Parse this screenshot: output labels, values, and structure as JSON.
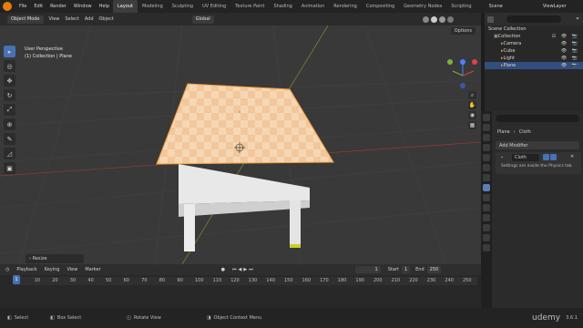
{
  "menu": [
    "File",
    "Edit",
    "Render",
    "Window",
    "Help"
  ],
  "workspaces": [
    "Layout",
    "Modeling",
    "Sculpting",
    "UV Editing",
    "Texture Paint",
    "Shading",
    "Animation",
    "Rendering",
    "Compositing",
    "Geometry Nodes",
    "Scripting"
  ],
  "scene": "Scene",
  "view_layer": "ViewLayer",
  "viewport": {
    "mode": "Object Mode",
    "menus": [
      "View",
      "Select",
      "Add",
      "Object"
    ],
    "orientation": "Global",
    "options": "Options",
    "overlay_line1": "User Perspective",
    "overlay_line2": "(1) Collection | Plane",
    "resize_panel": "Resize"
  },
  "outliner": {
    "scene_collection": "Scene Collection",
    "collection": "Collection",
    "items": [
      "Camera",
      "Cube",
      "Light",
      "Plane"
    ]
  },
  "properties": {
    "breadcrumb_object": "Plane",
    "breadcrumb_mod": "Cloth",
    "add_modifier": "Add Modifier",
    "mod_name": "Cloth",
    "info": "Settings are inside the Physics tab"
  },
  "timeline": {
    "menus": [
      "Playback",
      "Keying",
      "View",
      "Marker"
    ],
    "current": "1",
    "start_label": "Start",
    "start": "1",
    "end_label": "End",
    "end": "250",
    "ticks": [
      "1",
      "10",
      "20",
      "30",
      "40",
      "50",
      "60",
      "70",
      "80",
      "90",
      "100",
      "110",
      "120",
      "130",
      "140",
      "150",
      "160",
      "170",
      "180",
      "190",
      "200",
      "210",
      "220",
      "230",
      "240",
      "250"
    ]
  },
  "status": {
    "select": "Select",
    "box_select": "Box Select",
    "rotate": "Rotate View",
    "context": "Object Context Menu",
    "version": "3.6.1"
  },
  "watermark": "udemy"
}
